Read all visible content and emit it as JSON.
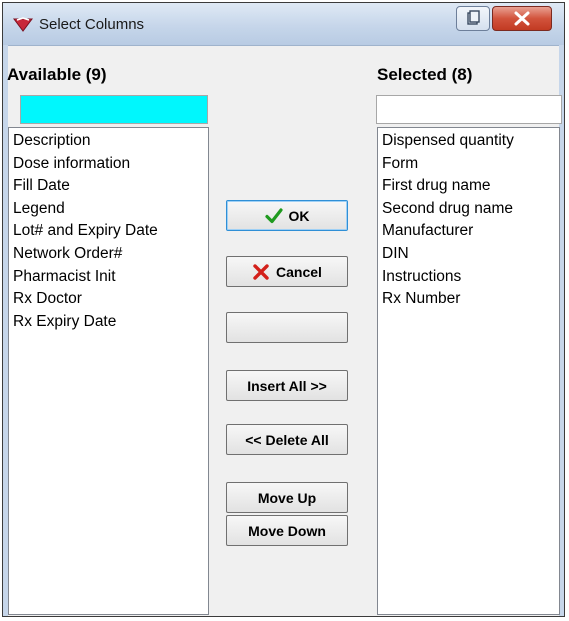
{
  "window": {
    "title": "Select Columns",
    "icon": "app-logo-icon",
    "controls": [
      "restore-icon",
      "close-icon"
    ]
  },
  "available": {
    "label": "Available (9)",
    "filter_value": "",
    "filter_color": "#00f7fd",
    "items": [
      "Description",
      "Dose information",
      "Fill Date",
      "Legend",
      "Lot# and Expiry Date",
      "Network Order#",
      "Pharmacist Init",
      "Rx Doctor",
      "Rx Expiry Date"
    ]
  },
  "selected": {
    "label": "Selected (8)",
    "filter_value": "",
    "items": [
      "Dispensed quantity",
      "Form",
      "First drug name",
      "Second drug name",
      "Manufacturer",
      "DIN",
      "Instructions",
      "Rx Number"
    ]
  },
  "buttons": {
    "ok": "OK",
    "ok_icon": "checkmark-icon",
    "cancel": "Cancel",
    "cancel_icon": "x-mark-icon",
    "blank": "",
    "insert_all": "Insert All >>",
    "delete_all": "<< Delete All",
    "move_up": "Move Up",
    "move_down": "Move Down"
  },
  "colors": {
    "ok_check": "#1f9a1f",
    "cancel_x": "#d3201a",
    "close_button": "#c94a36"
  }
}
